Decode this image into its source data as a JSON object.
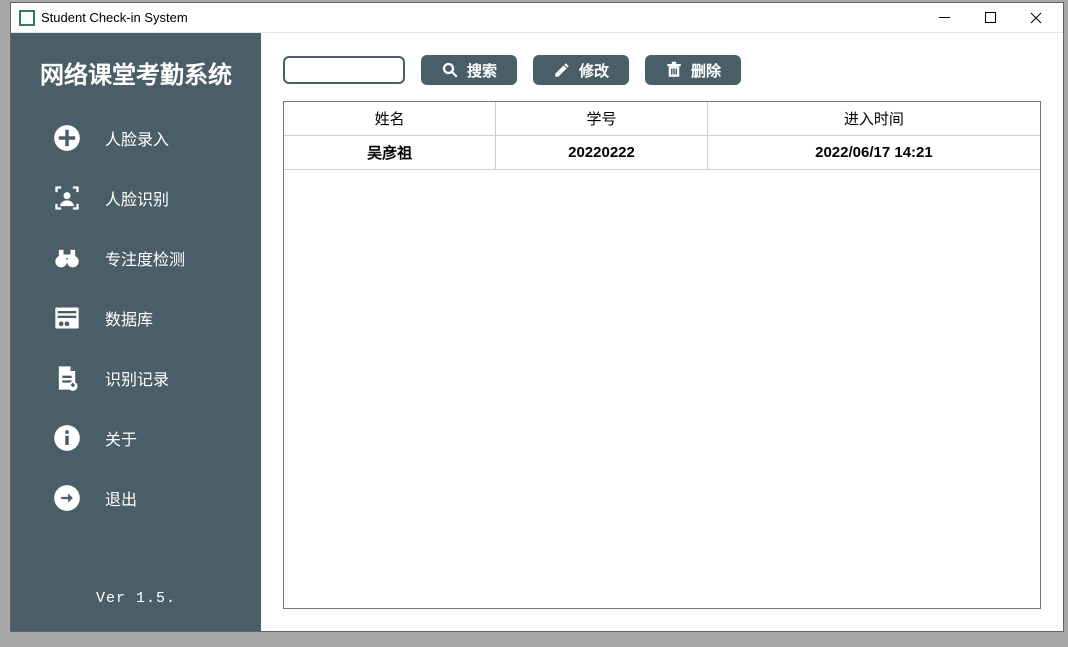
{
  "window": {
    "title": "Student Check-in System"
  },
  "sidebar": {
    "app_title": "网络课堂考勤系统",
    "items": [
      {
        "label": "人脸录入"
      },
      {
        "label": "人脸识别"
      },
      {
        "label": "专注度检测"
      },
      {
        "label": "数据库"
      },
      {
        "label": "识别记录"
      },
      {
        "label": "关于"
      },
      {
        "label": "退出"
      }
    ],
    "version": "Ver 1.5."
  },
  "toolbar": {
    "search_value": "",
    "search_label": "搜索",
    "modify_label": "修改",
    "delete_label": "删除"
  },
  "table": {
    "columns": [
      "姓名",
      "学号",
      "进入时间"
    ],
    "rows": [
      {
        "name": "吴彦祖",
        "id": "20220222",
        "time": "2022/06/17 14:21"
      }
    ]
  }
}
